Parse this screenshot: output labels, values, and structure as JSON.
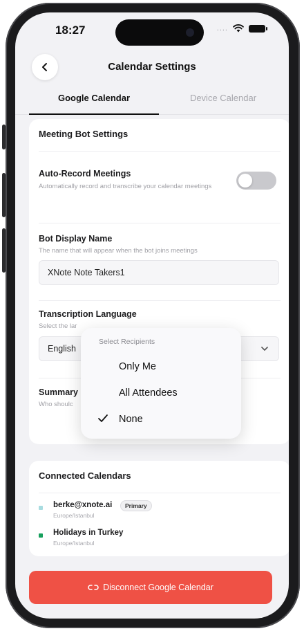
{
  "status_bar": {
    "time": "18:27",
    "signal_dots": "...."
  },
  "header": {
    "title": "Calendar Settings"
  },
  "tabs": [
    {
      "label": "Google Calendar",
      "active": true
    },
    {
      "label": "Device Calendar",
      "active": false
    }
  ],
  "meeting_bot": {
    "section_title": "Meeting Bot Settings",
    "auto_record": {
      "label": "Auto-Record Meetings",
      "description": "Automatically record and transcribe your calendar meetings",
      "enabled": false
    },
    "bot_display_name": {
      "label": "Bot Display Name",
      "description": "The name that will appear when the bot joins meetings",
      "value": "XNote Note Takers1"
    },
    "transcription_language": {
      "label": "Transcription Language",
      "description_visible": "Select the lar",
      "value": "English"
    },
    "summary": {
      "label_visible": "Summary",
      "description_visible": "Who shoulc"
    }
  },
  "recipients_popup": {
    "title": "Select Recipients",
    "options": [
      {
        "label": "Only Me",
        "selected": false
      },
      {
        "label": "All Attendees",
        "selected": false
      },
      {
        "label": "None",
        "selected": true
      }
    ]
  },
  "connected_calendars": {
    "section_title": "Connected Calendars",
    "items": [
      {
        "name": "berke@xnote.ai",
        "timezone": "Europe/Istanbul",
        "badge": "Primary",
        "color": "#a8dce0"
      },
      {
        "name": "Holidays in Turkey",
        "timezone": "Europe/Istanbul",
        "badge": "",
        "color": "#17a05d"
      }
    ]
  },
  "disconnect_button": {
    "label": "Disconnect Google Calendar"
  },
  "colors": {
    "danger": "#ef5145",
    "toggle_off": "#c9c9cd"
  }
}
